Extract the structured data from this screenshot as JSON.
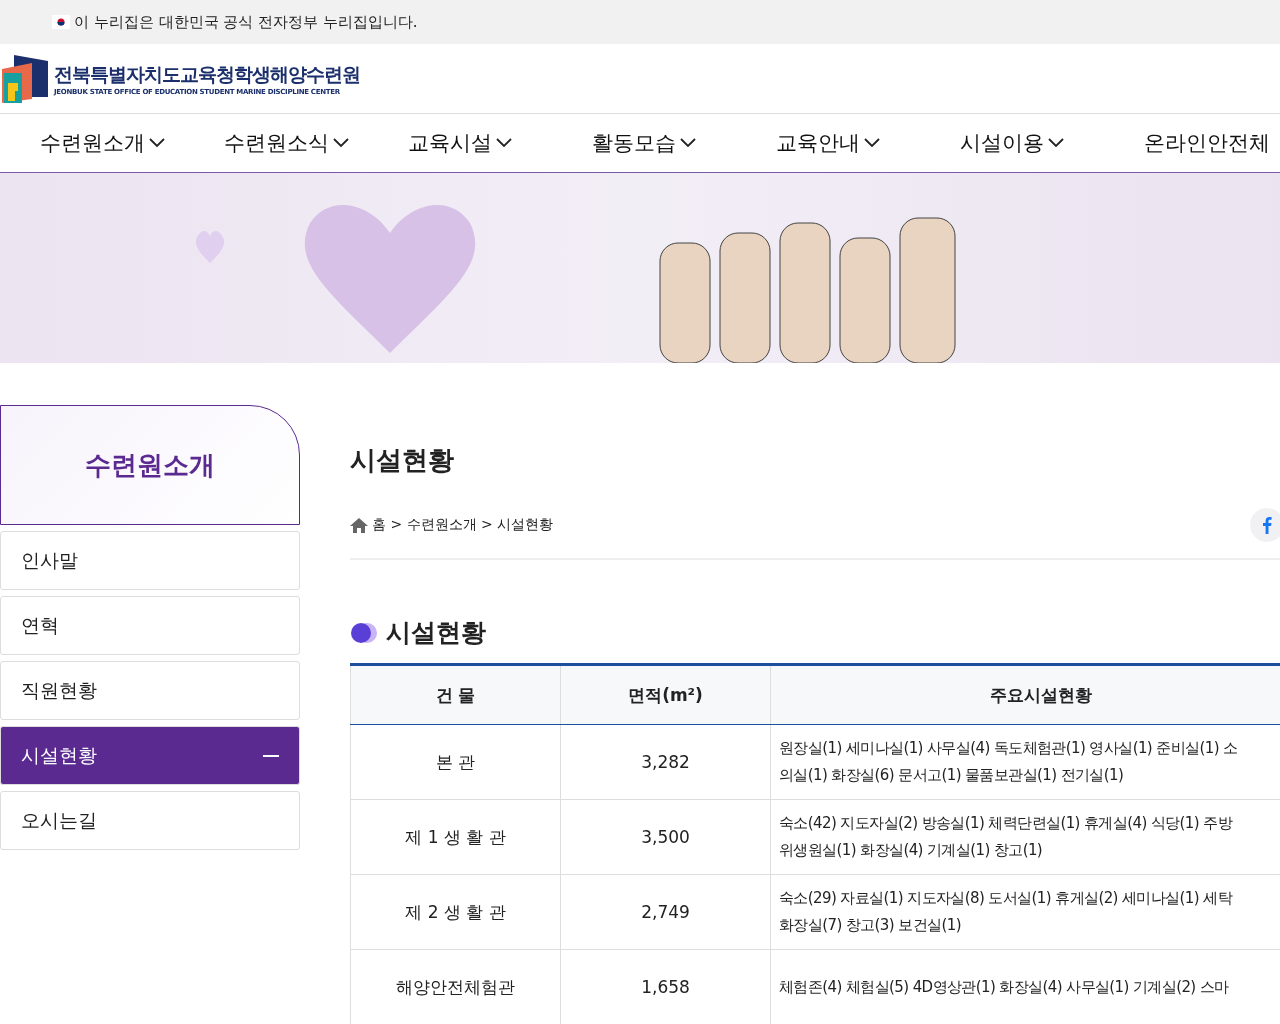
{
  "gov_banner": {
    "text": "이 누리집은 대한민국 공식 전자정부 누리집입니다."
  },
  "logo": {
    "title": "전북특별자치도교육청학생해양수련원",
    "subtitle": "JEONBUK STATE OFFICE  OF EDUCATION STUDENT MARINE DISCIPLINE CENTER"
  },
  "nav": [
    {
      "label": "수련원소개",
      "has_menu": true
    },
    {
      "label": "수련원소식",
      "has_menu": true
    },
    {
      "label": "교육시설",
      "has_menu": true
    },
    {
      "label": "활동모습",
      "has_menu": true
    },
    {
      "label": "교육안내",
      "has_menu": true
    },
    {
      "label": "시설이용",
      "has_menu": true
    },
    {
      "label": "온라인안전체",
      "has_menu": false
    }
  ],
  "sidebar": {
    "title": "수련원소개",
    "items": [
      {
        "label": "인사말",
        "selected": false
      },
      {
        "label": "연혁",
        "selected": false
      },
      {
        "label": "직원현황",
        "selected": false
      },
      {
        "label": "시설현황",
        "selected": true
      },
      {
        "label": "오시는길",
        "selected": false
      }
    ]
  },
  "page_title": "시설현황",
  "breadcrumb": "홈 > 수련원소개 > 시설현황",
  "section_title": "시설현황",
  "table": {
    "columns": [
      "건 물",
      "면적(m²)",
      "주요시설현황"
    ],
    "rows": [
      {
        "building": "본 관",
        "area": "3,282",
        "facilities": [
          "원장실(1) 세미나실(1) 사무실(4) 독도체험관(1) 영사실(1) 준비실(1) 소",
          "의실(1) 화장실(6) 문서고(1) 물품보관실(1) 전기실(1)"
        ]
      },
      {
        "building": "제 1 생 활 관",
        "area": "3,500",
        "facilities": [
          "숙소(42) 지도자실(2) 방송실(1) 체력단련실(1) 휴게실(4) 식당(1) 주방",
          "위생원실(1) 화장실(4) 기계실(1) 창고(1)"
        ]
      },
      {
        "building": "제 2 생 활 관",
        "area": "2,749",
        "facilities": [
          "숙소(29) 자료실(1) 지도자실(8) 도서실(1) 휴게실(2) 세미나실(1) 세탁",
          "화장실(7) 창고(3) 보건실(1)"
        ]
      },
      {
        "building": "해양안전체험관",
        "area": "1,658",
        "facilities": [
          "체험존(4) 체험실(5) 4D영상관(1) 화장실(4) 사무실(1) 기계실(2) 스마"
        ]
      }
    ]
  }
}
